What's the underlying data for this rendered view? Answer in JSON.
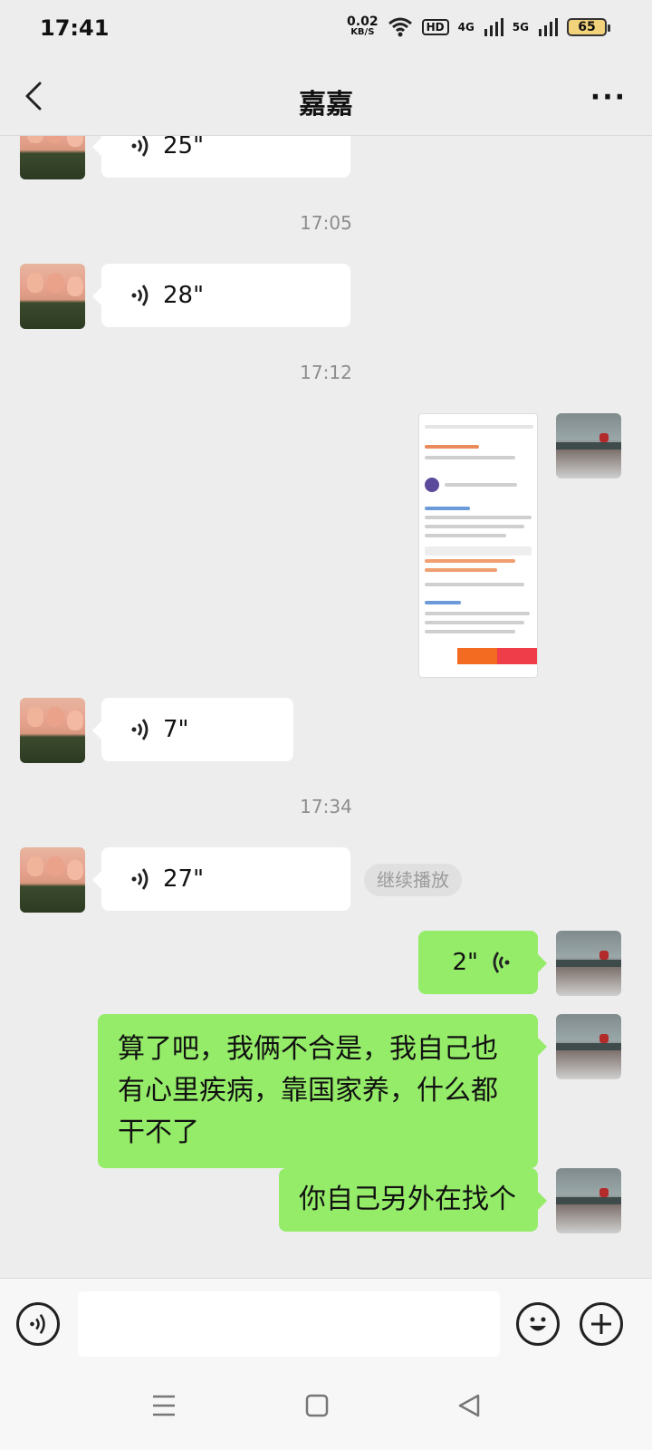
{
  "status": {
    "time": "17:41",
    "speed": "0.02",
    "speed_unit": "KB/S",
    "hd_label": "HD",
    "net1": "4G",
    "net2": "5G",
    "battery": "65"
  },
  "header": {
    "title": "嘉嘉",
    "more_label": "···"
  },
  "messages": {
    "m1_duration": "25\"",
    "ts1": "17:05",
    "m2_duration": "28\"",
    "ts2": "17:12",
    "m4_duration": "7\"",
    "ts3": "17:34",
    "m5_duration": "27\"",
    "continue_label": "继续播放",
    "m6_duration": "2\"",
    "m7_text": "算了吧，我俩不合是，我自己也有心里疾病，靠国家养，什么都干不了",
    "m8_text": "你自己另外在找个"
  },
  "colors": {
    "green_bubble": "#95ec69",
    "white_bubble": "#ffffff",
    "background": "#ededed"
  }
}
